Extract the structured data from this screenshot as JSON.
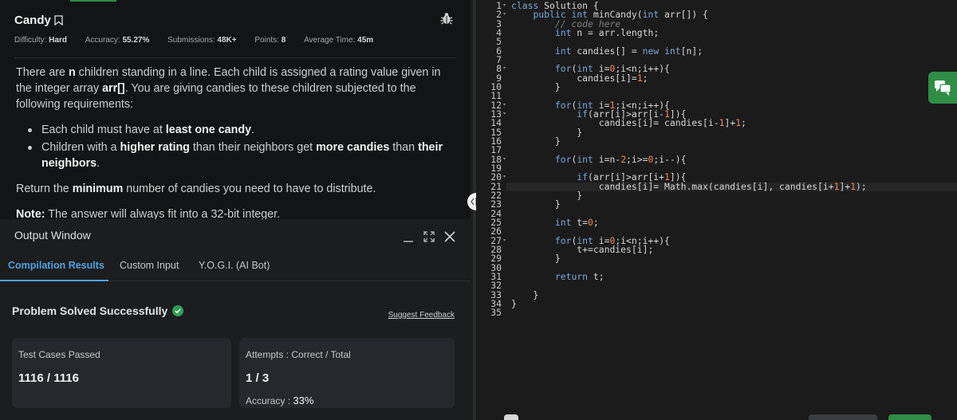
{
  "problem": {
    "title": "Candy",
    "meta": [
      {
        "label": "Difficulty:",
        "value": "Hard"
      },
      {
        "label": "Accuracy:",
        "value": "55.27%"
      },
      {
        "label": "Submissions:",
        "value": "48K+"
      },
      {
        "label": "Points:",
        "value": "8"
      },
      {
        "label": "Average Time:",
        "value": "45m"
      }
    ],
    "p1_a": "There are ",
    "p1_n": "n",
    "p1_b": " children standing in a line. Each child is assigned a rating value given in the integer array ",
    "p1_arr": "arr[]",
    "p1_c": ". You are giving candies to these children subjected to the following requirements:",
    "b1_a": "Each child must have at ",
    "b1_b": "least one candy",
    "b1_c": ".",
    "b2_a": "Children with a ",
    "b2_b": "higher rating",
    "b2_c": " than their neighbors get ",
    "b2_d": "more candies",
    "b2_e": " than ",
    "b2_f": "their neighbors",
    "b2_g": ".",
    "p2_a": "Return the ",
    "p2_b": "minimum",
    "p2_c": " number of candies you need to have to distribute.",
    "note_label": "Note:",
    "note_text": " The answer will always fit into a 32-bit integer."
  },
  "output": {
    "title": "Output Window",
    "tabs": [
      "Compilation Results",
      "Custom Input",
      "Y.O.G.I. (AI Bot)"
    ],
    "status": "Problem Solved Successfully",
    "feedback": "Suggest Feedback",
    "tests_label": "Test Cases Passed",
    "tests_value": "1116 / 1116",
    "attempts_label": "Attempts : Correct / Total",
    "attempts_value": "1 / 3",
    "accuracy_label": "Accuracy : ",
    "accuracy_value": "33%"
  },
  "editor": {
    "line_count": 35,
    "fold_lines": [
      1,
      2,
      8,
      12,
      13,
      18,
      20,
      27
    ],
    "current_line": 21,
    "code": [
      "class Solution {",
      "    public int minCandy(int arr[]) {",
      "        // code here",
      "        int n = arr.length;",
      "",
      "        int candies[] = new int[n];",
      "",
      "        for(int i=0;i<n;i++){",
      "            candies[i]=1;",
      "        }",
      "",
      "        for(int i=1;i<n;i++){",
      "            if(arr[i]>arr[i-1]){",
      "                candies[i]= candies[i-1]+1;",
      "            }",
      "        }",
      "",
      "        for(int i=n-2;i>=0;i--){",
      "",
      "            if(arr[i]>arr[i+1]){",
      "                candies[i]= Math.max(candies[i], candies[i+1]+1);",
      "            }",
      "        }",
      "",
      "        int t=0;",
      "",
      "        for(int i=0;i<n;i++){",
      "            t+=candies[i];",
      "        }",
      "",
      "        return t;",
      "",
      "    }",
      "}",
      ""
    ]
  },
  "colors": {
    "accent_green": "#2f8d46",
    "tab_active": "#4fa3e0",
    "success": "#2f9e58"
  }
}
